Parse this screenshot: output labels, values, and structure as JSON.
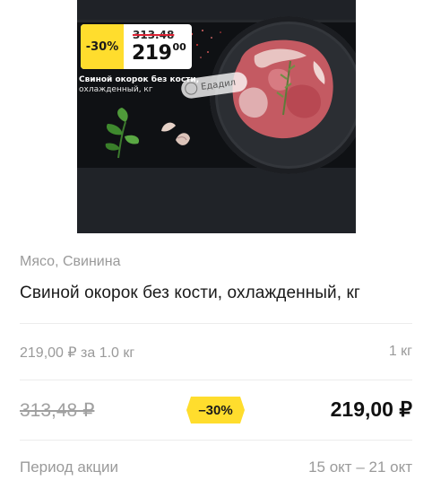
{
  "product_image": {
    "sticker": {
      "discount": "-30%",
      "old_price": "313.48",
      "new_price_integer": "219",
      "new_price_cents": "00"
    },
    "name": "Свиной окорок без кости,",
    "unit": "охлажденный, кг",
    "watermark": "Едадил"
  },
  "details": {
    "category": "Мясо, Свинина",
    "title": "Свиной окорок без кости, охлажденный, кг",
    "unit_price": "219,00 ₽ за 1.0 кг",
    "unit_amount": "1 кг",
    "old_price": "313,48 ₽",
    "discount_badge": "–30%",
    "new_price": "219,00 ₽",
    "period_label": "Период акции",
    "period_value": "15 окт – 21 окт"
  },
  "colors": {
    "badge": "#ffdd2d",
    "muted_text": "#9a9a9a",
    "primary_text": "#1a1a1a"
  }
}
